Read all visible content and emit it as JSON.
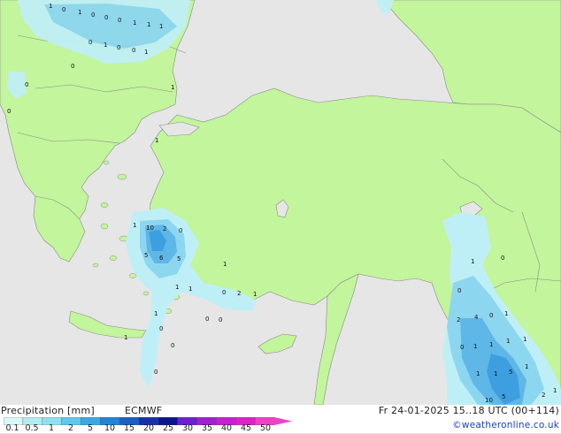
{
  "legend": {
    "title": "Precipitation [mm]",
    "model": "ECMWF",
    "run": "Fr 24-01-2025 15..18 UTC (00+114)",
    "credit": "©weatheronline.co.uk",
    "ticks": [
      "0.1",
      "0.5",
      "1",
      "2",
      "5",
      "10",
      "15",
      "20",
      "25",
      "30",
      "35",
      "40",
      "45",
      "50"
    ],
    "colors": [
      "#d9f7f7",
      "#b4ecf3",
      "#8fdfef",
      "#5fc8eb",
      "#3aa9e3",
      "#1f86d6",
      "#1a5fc4",
      "#1530a8",
      "#0b1590",
      "#6d1fd1",
      "#a31fd6",
      "#c81fd2",
      "#e020c9",
      "#f040c8"
    ]
  },
  "colors": {
    "land": "#c3f59c",
    "sea": "#e6e6e6",
    "border": "#8a8a8a",
    "precip_light": "#bfeff6",
    "precip_medium": "#8dd6f0",
    "precip_heavy": "#3d9fe0"
  },
  "map_values": [
    "1",
    "0",
    "1",
    "0",
    "0",
    "0",
    "1",
    "1",
    "1",
    "0",
    "1",
    "0",
    "0",
    "0",
    "1",
    "0",
    "1",
    "0",
    "1",
    "1",
    "10",
    "2",
    "0",
    "5",
    "6",
    "5",
    "1",
    "1",
    "0",
    "2",
    "1",
    "1",
    "0",
    "0",
    "1",
    "0",
    "1",
    "0",
    "0",
    "1",
    "0",
    "2",
    "4",
    "0",
    "1",
    "0",
    "1",
    "1",
    "1",
    "0",
    "1",
    "5",
    "1",
    "1",
    "1",
    "10",
    "5",
    "2",
    "1"
  ]
}
